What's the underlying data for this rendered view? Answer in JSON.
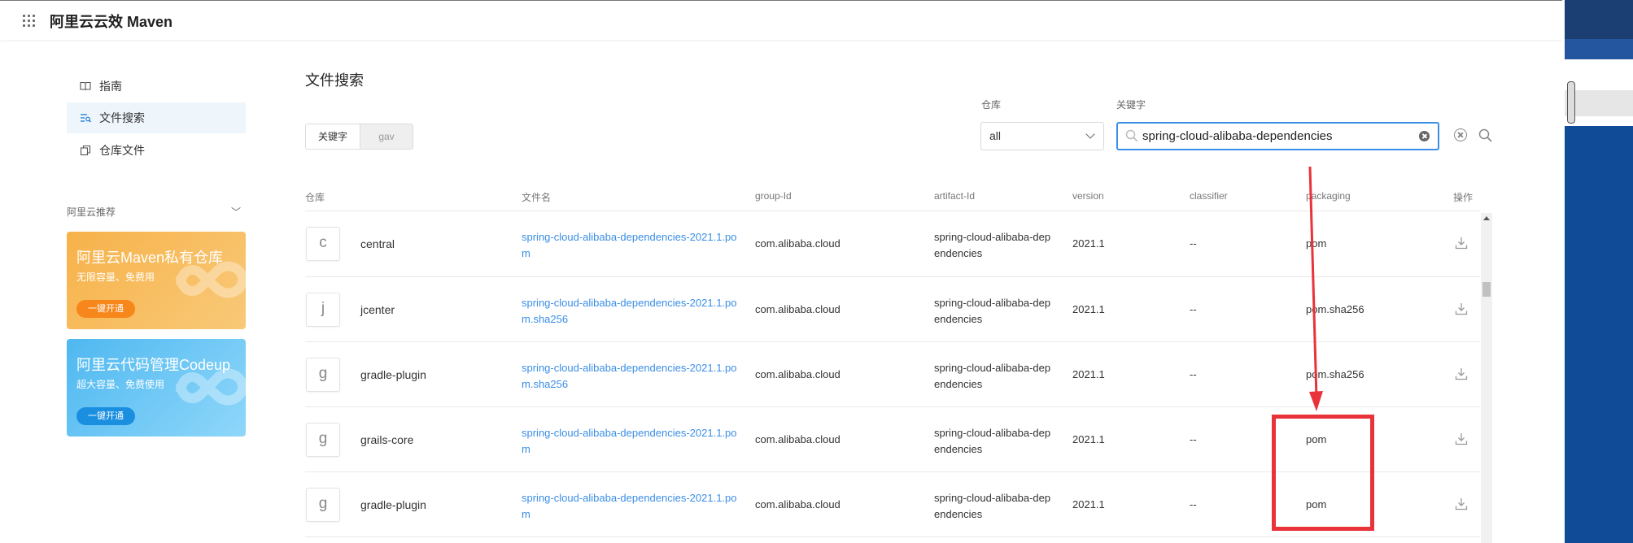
{
  "header": {
    "app_title": "阿里云云效 Maven",
    "menu_icon": "grid-icon"
  },
  "sidebar": {
    "items": [
      {
        "label": "指南",
        "icon": "book-icon",
        "active": false
      },
      {
        "label": "文件搜索",
        "icon": "file-search-icon",
        "active": true
      },
      {
        "label": "仓库文件",
        "icon": "files-icon",
        "active": false
      }
    ],
    "recommend_title": "阿里云推荐",
    "promos": [
      {
        "title": "阿里云Maven私有仓库",
        "subtitle": "无限容量、免费用",
        "button": "一键开通",
        "color": "#f5a93c",
        "button_color": "#f7861b"
      },
      {
        "title": "阿里云代码管理Codeup",
        "subtitle": "超大容量、免费使用",
        "button": "一键开通",
        "color": "#5cc0f2",
        "button_color": "#1a8fe0"
      }
    ]
  },
  "main": {
    "title": "文件搜索",
    "mode_tabs": [
      "关键字",
      "gav"
    ],
    "repo_label": "仓库",
    "repo_value": "all",
    "keyword_label": "关键字",
    "keyword_value": "spring-cloud-alibaba-dependencies"
  },
  "table": {
    "columns": [
      "仓库",
      "文件名",
      "group-Id",
      "artifact-Id",
      "version",
      "classifier",
      "packaging",
      "操作"
    ],
    "rows": [
      {
        "badge": "c",
        "repo": "central",
        "file": "spring-cloud-alibaba-dependencies-2021.1.pom",
        "group": "com.alibaba.cloud",
        "artifact": "spring-cloud-alibaba-dependencies",
        "version": "2021.1",
        "classifier": "--",
        "packaging": "pom"
      },
      {
        "badge": "j",
        "repo": "jcenter",
        "file": "spring-cloud-alibaba-dependencies-2021.1.pom.sha256",
        "group": "com.alibaba.cloud",
        "artifact": "spring-cloud-alibaba-dependencies",
        "version": "2021.1",
        "classifier": "--",
        "packaging": "pom.sha256"
      },
      {
        "badge": "g",
        "repo": "gradle-plugin",
        "file": "spring-cloud-alibaba-dependencies-2021.1.pom.sha256",
        "group": "com.alibaba.cloud",
        "artifact": "spring-cloud-alibaba-dependencies",
        "version": "2021.1",
        "classifier": "--",
        "packaging": "pom.sha256"
      },
      {
        "badge": "g",
        "repo": "grails-core",
        "file": "spring-cloud-alibaba-dependencies-2021.1.pom",
        "group": "com.alibaba.cloud",
        "artifact": "spring-cloud-alibaba-dependencies",
        "version": "2021.1",
        "classifier": "--",
        "packaging": "pom"
      },
      {
        "badge": "g",
        "repo": "gradle-plugin",
        "file": "spring-cloud-alibaba-dependencies-2021.1.pom",
        "group": "com.alibaba.cloud",
        "artifact": "spring-cloud-alibaba-dependencies",
        "version": "2021.1",
        "classifier": "--",
        "packaging": "pom"
      }
    ]
  },
  "annotation": {
    "color": "#e8333a"
  }
}
